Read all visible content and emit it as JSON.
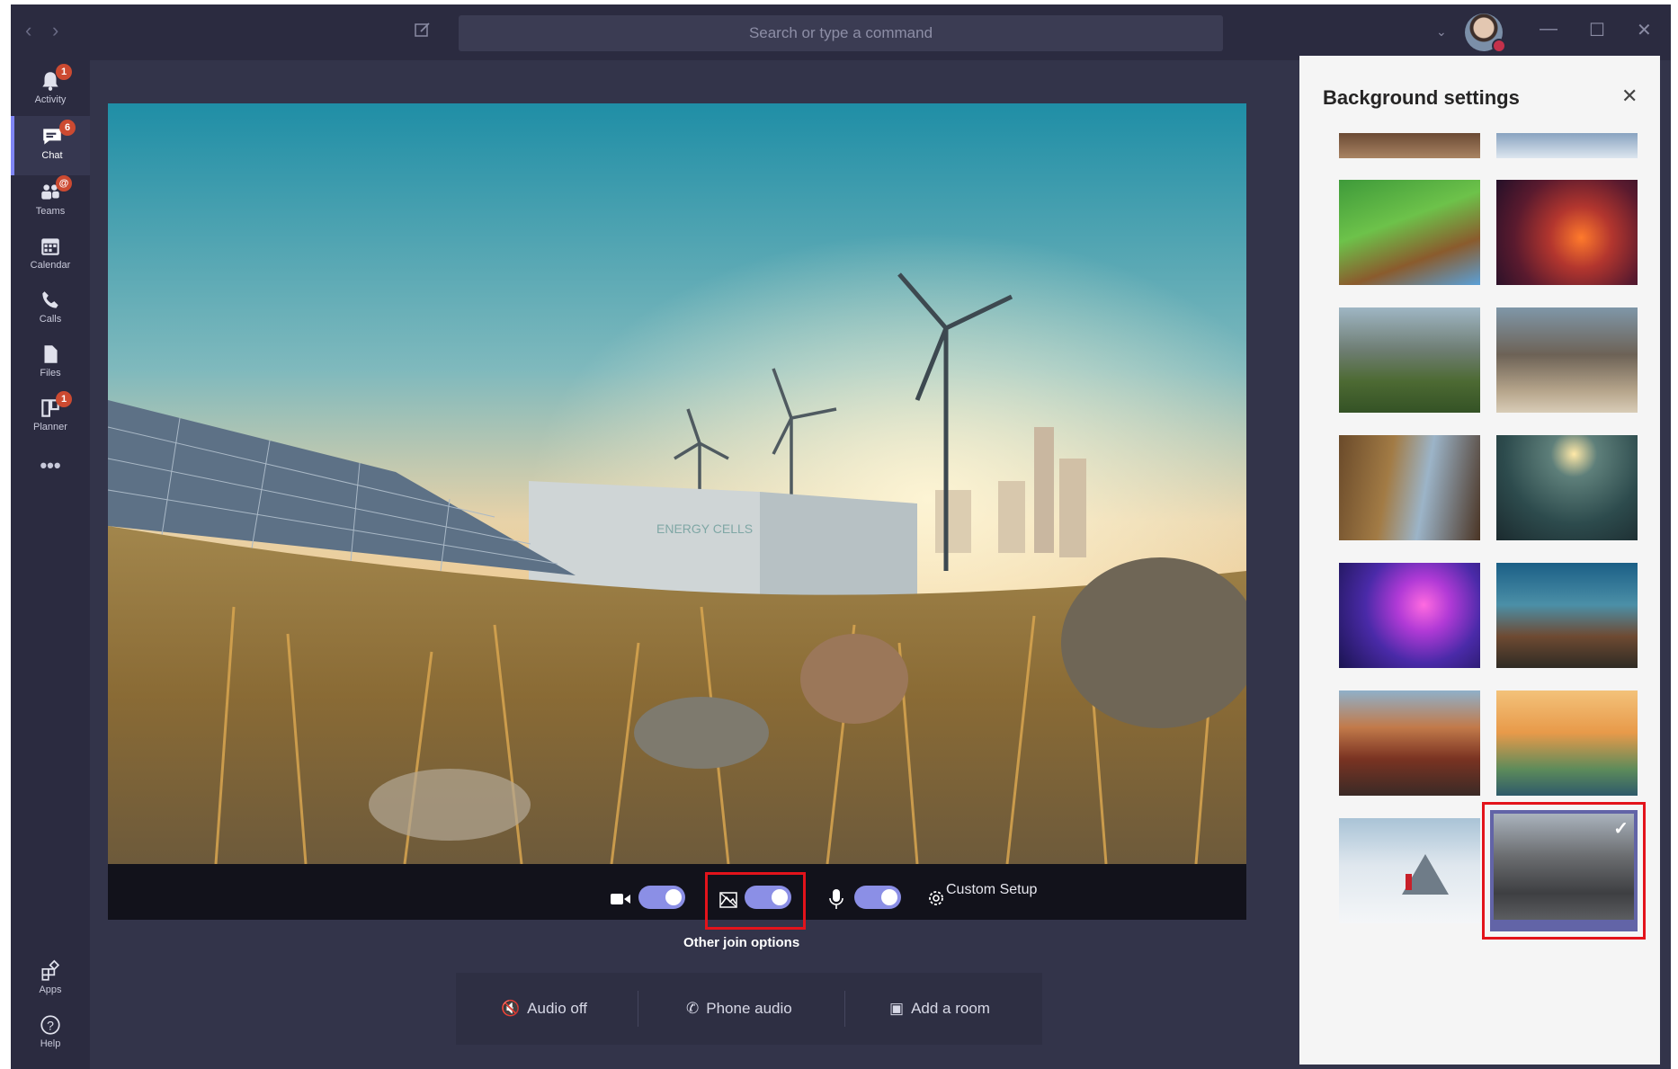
{
  "titlebar": {
    "search_placeholder": "Search or type a command"
  },
  "rail": {
    "items": [
      {
        "label": "Activity",
        "badge": "1"
      },
      {
        "label": "Chat",
        "badge": "6"
      },
      {
        "label": "Teams",
        "badge": "@"
      },
      {
        "label": "Calendar",
        "badge": ""
      },
      {
        "label": "Calls",
        "badge": ""
      },
      {
        "label": "Files",
        "badge": ""
      },
      {
        "label": "Planner",
        "badge": "1"
      },
      {
        "label": "•••",
        "badge": ""
      }
    ],
    "bottom": [
      {
        "label": "Apps"
      },
      {
        "label": "Help"
      }
    ]
  },
  "preview": {
    "sign_text": "ENERGY CELLS"
  },
  "controls": {
    "camera_on": true,
    "background_effects_on": true,
    "mic_on": true,
    "custom_setup_label": "Custom Setup"
  },
  "join": {
    "other_options_label": "Other join options",
    "audio_off": "Audio off",
    "phone_audio": "Phone audio",
    "add_room": "Add a room"
  },
  "panel": {
    "title": "Background settings",
    "selected_index": 13,
    "thumbnails": [
      "minecraft-village",
      "minecraft-nether",
      "mountain-valley",
      "ruins-arch",
      "fantasy-alley",
      "space-planet",
      "nebula",
      "alien-coast",
      "autumn-street",
      "sunset-hills",
      "snow-mountain-hiker",
      "old-town-street"
    ]
  },
  "colors": {
    "accent": "#8b8fe6",
    "highlight": "#e3131b",
    "badge": "#cc4a31"
  }
}
